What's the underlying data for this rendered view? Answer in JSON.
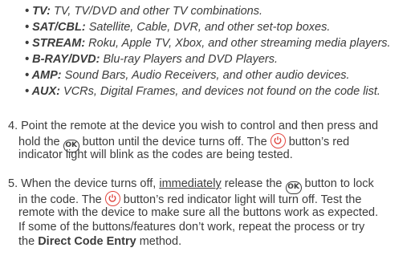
{
  "bullets": [
    {
      "key": "• TV:",
      "text": " TV, TV/DVD and other TV combinations."
    },
    {
      "key": "• SAT/CBL:",
      "text": " Satellite, Cable, DVR, and other set-top boxes."
    },
    {
      "key": "• STREAM:",
      "text": " Roku, Apple TV, Xbox, and other streaming media players."
    },
    {
      "key": "• B-RAY/DVD:",
      "text": " Blu-ray Players and DVD Players."
    },
    {
      "key": "• AMP:",
      "text": " Sound Bars, Audio Receivers, and other audio devices."
    },
    {
      "key": "• AUX:",
      "text": " VCRs, Digital Frames, and devices not found on the code list."
    }
  ],
  "step4": {
    "l1": "4. Point the remote at the device you wish to control and then press and",
    "l2a": "hold the ",
    "ok_icon": "OK",
    "l2b": " button until the device turns off. The ",
    "l2c": " button’s red",
    "l3": "indicator light will blink as the codes are being tested."
  },
  "step5": {
    "l1a": "5. When the device turns off, ",
    "l1u": "immediately",
    "l1b": " release the ",
    "ok_icon": "OK",
    "l1c": " button to lock",
    "l2a": "in the code. The ",
    "l2b": " button’s red indicator light will turn off. Test the",
    "l3": "remote with the device to make sure all the buttons work as expected.",
    "l4": "If some of the buttons/features don’t work, repeat the process or try",
    "l5a": "the ",
    "l5b": "Direct Code Entry",
    "l5c": " method."
  },
  "icons": {
    "ok": "ok-button-icon",
    "power": "power-button-icon"
  },
  "colors": {
    "text": "#3c3c3c",
    "power_icon": "#e0463f"
  }
}
